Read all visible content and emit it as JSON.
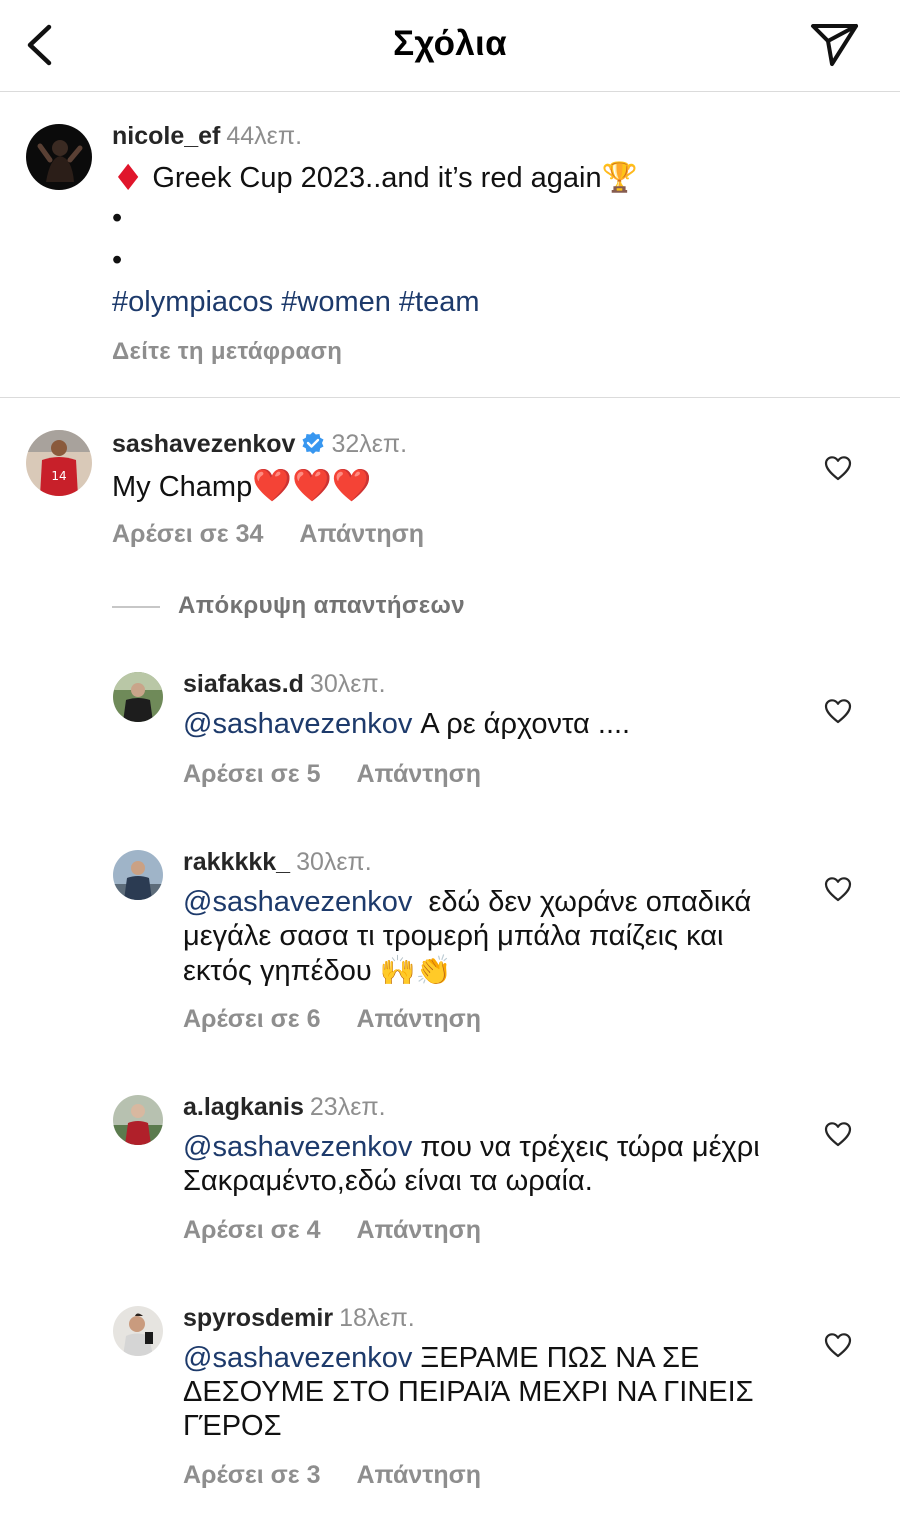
{
  "header": {
    "title": "Σχόλια"
  },
  "caption": {
    "username": "nicole_ef",
    "time": "44λεπ.",
    "line1_emoji": "♦",
    "line1_text": "Greek Cup 2023..and it’s red again",
    "line1_trophy": "🏆",
    "dot1": "•",
    "dot2": "•",
    "hashtags": "#olympiacos #women #team",
    "translate": "Δείτε τη μετάφραση"
  },
  "comment": {
    "username": "sashavezenkov",
    "time": "32λεπ.",
    "text": "My Champ",
    "hearts": "❤️❤️❤️",
    "likes": "Αρέσει σε 34",
    "reply": "Απάντηση"
  },
  "hide_replies": "Απόκρυψη απαντήσεων",
  "replies": [
    {
      "username": "siafakas.d",
      "time": "30λεπ.",
      "mention": "@sashavezenkov",
      "lines": [
        " Α ρε άρχοντα ...."
      ],
      "likes": "Αρέσει σε 5",
      "reply": "Απάντηση"
    },
    {
      "username": "rakkkkk_",
      "time": "30λεπ.",
      "mention": "@sashavezenkov",
      "lines": [
        "  εδώ δεν χωράνε οπαδικά",
        "μεγάλε σασα τι τρομερή μπάλα παίζεις και",
        "εκτός γηπέδου 🙌👏"
      ],
      "likes": "Αρέσει σε 6",
      "reply": "Απάντηση"
    },
    {
      "username": "a.lagkanis",
      "time": "23λεπ.",
      "mention": "@sashavezenkov",
      "lines": [
        " που να τρέχεις τώρα μέχρι",
        "Σακραμέντο,εδώ είναι τα ωραία."
      ],
      "likes": "Αρέσει σε 4",
      "reply": "Απάντηση"
    },
    {
      "username": "spyrosdemir",
      "time": "18λεπ.",
      "mention": "@sashavezenkov",
      "lines": [
        " ΞΕΡΑΜΕ ΠΩΣ ΝΑ ΣΕ",
        "ΔΕΣΟΥΜΕ ΣΤΟ ΠΕΙΡΑΙΆ ΜΕΧΡΙ ΝΑ ΓΙΝΕΙΣ",
        "ΓΈΡΟΣ"
      ],
      "likes": "Αρέσει σε 3",
      "reply": "Απάντηση"
    }
  ],
  "colors": {
    "link": "#1d3a6b",
    "muted": "#8e8e8e",
    "divider": "#dbdbdb",
    "heart_red": "#e0152b",
    "verified": "#3897f0"
  },
  "icons": {
    "back": "chevron-left-icon",
    "share": "paper-plane-icon",
    "like": "heart-outline-icon",
    "verified": "verified-badge-icon"
  }
}
